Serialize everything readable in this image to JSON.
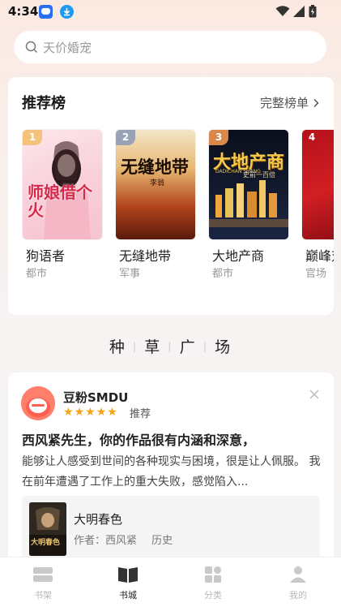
{
  "status": {
    "time": "4:34"
  },
  "search": {
    "placeholder": "天价婚宠"
  },
  "ranking": {
    "title": "推荐榜",
    "more": "完整榜单",
    "books": [
      {
        "rank": "1",
        "name": "狗语者",
        "category": "都市",
        "cover_title": "师娘借个火"
      },
      {
        "rank": "2",
        "name": "无缝地带",
        "category": "军事",
        "cover_title": "无缝地带",
        "cover_author": "李翁"
      },
      {
        "rank": "3",
        "name": "大地产商",
        "category": "都市",
        "cover_title": "大地产商",
        "cover_sub": "DADICHAN SHANG",
        "cover_author": "史前一百倍"
      },
      {
        "rank": "4",
        "name": "巅峰对决",
        "category": "官场"
      }
    ]
  },
  "section": {
    "chars": [
      "种",
      "草",
      "广",
      "场"
    ]
  },
  "review": {
    "user": "豆粉SMDU",
    "rating": 5,
    "recommend": "推荐",
    "title": "西风紧先生，你的作品很有内涵和深意，",
    "body": "能够让人感受到世间的各种现实与困境，很是让人佩服。 我在前年遭遇了工作上的重大失败，感觉陷入...",
    "book": {
      "name": "大明春色",
      "author_label": "作者：",
      "author": "西风紧",
      "category": "历史",
      "cover_title": "大明春色"
    }
  },
  "tabs": [
    {
      "label": "书架",
      "icon": "bookshelf-icon"
    },
    {
      "label": "书城",
      "icon": "book-open-icon",
      "active": true
    },
    {
      "label": "分类",
      "icon": "category-grid-icon"
    },
    {
      "label": "我的",
      "icon": "person-icon"
    }
  ],
  "colors": {
    "accent": "#f7a21b",
    "rank1": "#f4c27a",
    "rank2": "#9aa3b5",
    "rank3": "#d9874a"
  }
}
